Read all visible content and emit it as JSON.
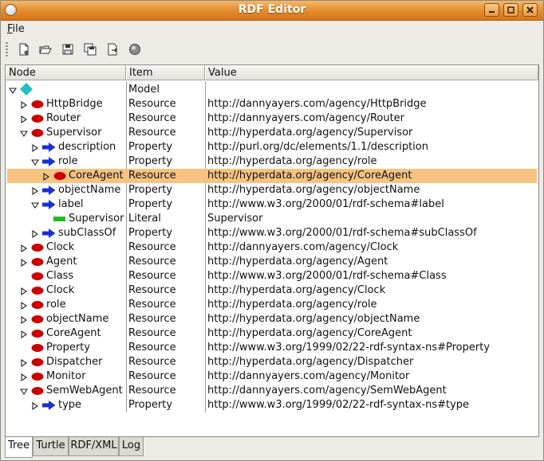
{
  "window": {
    "title": "RDF Editor"
  },
  "menu": {
    "file_label": "File"
  },
  "toolbar": {
    "icons": [
      "new-document-icon",
      "open-folder-icon",
      "save-icon",
      "save-all-icon",
      "export-icon",
      "stop-icon"
    ]
  },
  "table": {
    "columns": {
      "node": "Node",
      "item": "Item",
      "value": "Value"
    },
    "rows": [
      {
        "depth": 0,
        "expander": "open",
        "icon": "model",
        "node": "",
        "item": "Model",
        "value": ""
      },
      {
        "depth": 1,
        "expander": "closed",
        "icon": "resource",
        "node": "HttpBridge",
        "item": "Resource",
        "value": "http://dannyayers.com/agency/HttpBridge"
      },
      {
        "depth": 1,
        "expander": "closed",
        "icon": "resource",
        "node": "Router",
        "item": "Resource",
        "value": "http://dannyayers.com/agency/Router"
      },
      {
        "depth": 1,
        "expander": "open",
        "icon": "resource",
        "node": "Supervisor",
        "item": "Resource",
        "value": "http://hyperdata.org/agency/Supervisor"
      },
      {
        "depth": 2,
        "expander": "closed",
        "icon": "property",
        "node": "description",
        "item": "Property",
        "value": "http://purl.org/dc/elements/1.1/description"
      },
      {
        "depth": 2,
        "expander": "open",
        "icon": "property",
        "node": "role",
        "item": "Property",
        "value": "http://hyperdata.org/agency/role"
      },
      {
        "depth": 3,
        "expander": "closed",
        "icon": "resource",
        "node": "CoreAgent",
        "item": "Resource",
        "value": "http://hyperdata.org/agency/CoreAgent",
        "selected": true
      },
      {
        "depth": 2,
        "expander": "closed",
        "icon": "property",
        "node": "objectName",
        "item": "Property",
        "value": "http://hyperdata.org/agency/objectName"
      },
      {
        "depth": 2,
        "expander": "open",
        "icon": "property",
        "node": "label",
        "item": "Property",
        "value": "http://www.w3.org/2000/01/rdf-schema#label"
      },
      {
        "depth": 3,
        "expander": "none",
        "icon": "literal",
        "node": "Supervisor",
        "item": "Literal",
        "value": "Supervisor"
      },
      {
        "depth": 2,
        "expander": "closed",
        "icon": "property",
        "node": "subClassOf",
        "item": "Property",
        "value": "http://www.w3.org/2000/01/rdf-schema#subClassOf"
      },
      {
        "depth": 1,
        "expander": "closed",
        "icon": "resource",
        "node": "Clock",
        "item": "Resource",
        "value": "http://dannyayers.com/agency/Clock"
      },
      {
        "depth": 1,
        "expander": "closed",
        "icon": "resource",
        "node": "Agent",
        "item": "Resource",
        "value": "http://hyperdata.org/agency/Agent"
      },
      {
        "depth": 1,
        "expander": "none",
        "icon": "resource",
        "node": "Class",
        "item": "Resource",
        "value": "http://www.w3.org/2000/01/rdf-schema#Class"
      },
      {
        "depth": 1,
        "expander": "closed",
        "icon": "resource",
        "node": "Clock",
        "item": "Resource",
        "value": "http://hyperdata.org/agency/Clock"
      },
      {
        "depth": 1,
        "expander": "closed",
        "icon": "resource",
        "node": "role",
        "item": "Resource",
        "value": "http://hyperdata.org/agency/role"
      },
      {
        "depth": 1,
        "expander": "closed",
        "icon": "resource",
        "node": "objectName",
        "item": "Resource",
        "value": "http://hyperdata.org/agency/objectName"
      },
      {
        "depth": 1,
        "expander": "closed",
        "icon": "resource",
        "node": "CoreAgent",
        "item": "Resource",
        "value": "http://hyperdata.org/agency/CoreAgent"
      },
      {
        "depth": 1,
        "expander": "none",
        "icon": "resource",
        "node": "Property",
        "item": "Resource",
        "value": "http://www.w3.org/1999/02/22-rdf-syntax-ns#Property"
      },
      {
        "depth": 1,
        "expander": "closed",
        "icon": "resource",
        "node": "Dispatcher",
        "item": "Resource",
        "value": "http://hyperdata.org/agency/Dispatcher"
      },
      {
        "depth": 1,
        "expander": "closed",
        "icon": "resource",
        "node": "Monitor",
        "item": "Resource",
        "value": "http://dannyayers.com/agency/Monitor"
      },
      {
        "depth": 1,
        "expander": "open",
        "icon": "resource",
        "node": "SemWebAgent",
        "item": "Resource",
        "value": "http://dannyayers.com/agency/SemWebAgent"
      },
      {
        "depth": 2,
        "expander": "closed",
        "icon": "property",
        "node": "type",
        "item": "Property",
        "value": "http://www.w3.org/1999/02/22-rdf-syntax-ns#type"
      }
    ]
  },
  "tabs": [
    {
      "label": "Tree",
      "active": true
    },
    {
      "label": "Turtle",
      "active": false
    },
    {
      "label": "RDF/XML",
      "active": false
    },
    {
      "label": "Log",
      "active": false
    }
  ],
  "colors": {
    "title_bar": "#e38a2a",
    "selection": "#f6c380",
    "resource_icon": "#cc0000",
    "property_icon": "#1a2fd0",
    "literal_icon": "#22bb22",
    "model_icon": "#22c0c0"
  }
}
